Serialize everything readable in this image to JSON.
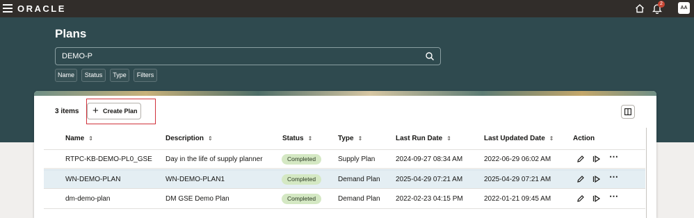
{
  "brand": {
    "logo": "ORACLE",
    "notification_count": "2",
    "avatar_initials": "AA"
  },
  "page": {
    "title": "Plans"
  },
  "search": {
    "value": "DEMO-P"
  },
  "filters": [
    "Name",
    "Status",
    "Type",
    "Filters"
  ],
  "toolbar": {
    "items_count": "3 items",
    "create_label": "Create Plan"
  },
  "table": {
    "columns": [
      "Name",
      "Description",
      "Status",
      "Type",
      "Last Run Date",
      "Last Updated Date",
      "Action"
    ],
    "rows": [
      {
        "name": "RTPC-KB-DEMO-PL0_GSE",
        "description": "Day in the life of supply planner",
        "status": "Completed",
        "type": "Supply Plan",
        "last_run": "2024-09-27 08:34 AM",
        "last_updated": "2022-06-29 06:02 AM"
      },
      {
        "name": "WN-DEMO-PLAN",
        "description": "WN-DEMO-PLAN1",
        "status": "Completed",
        "type": "Demand Plan",
        "last_run": "2025-04-29 07:21 AM",
        "last_updated": "2025-04-29 07:21 AM"
      },
      {
        "name": "dm-demo-plan",
        "description": "DM GSE Demo Plan",
        "status": "Completed",
        "type": "Demand Plan",
        "last_run": "2022-02-23 04:15 PM",
        "last_updated": "2022-01-21 09:45 AM"
      }
    ]
  },
  "icons": [
    "menu-icon",
    "home-icon",
    "bell-icon",
    "search-icon",
    "plus-icon",
    "panel-toggle-icon",
    "sort-icon",
    "edit-icon",
    "run-icon",
    "more-icon"
  ],
  "colors": {
    "topbar": "#312d2a",
    "hero": "#2f4a4f",
    "status_badge": "#d4e8c3",
    "selected_row": "#e4eef3",
    "highlight": "#d0303a"
  }
}
